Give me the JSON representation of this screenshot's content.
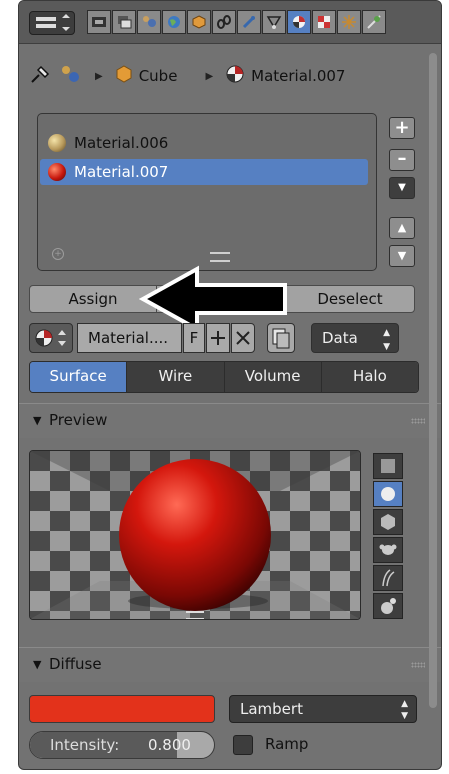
{
  "breadcrumb": {
    "object": "Cube",
    "material": "Material.007"
  },
  "slots": [
    {
      "name": "Material.006",
      "color": "#b89a5c",
      "selected": false
    },
    {
      "name": "Material.007",
      "color": "#c8180e",
      "selected": true
    }
  ],
  "buttons": {
    "assign": "Assign",
    "deselect": "Deselect"
  },
  "selector": {
    "material_name": "Material....",
    "fake_user": "F",
    "link_type": "Data"
  },
  "tabs": [
    "Surface",
    "Wire",
    "Volume",
    "Halo"
  ],
  "sections": {
    "preview": "Preview",
    "diffuse": "Diffuse"
  },
  "diffuse": {
    "color": "#e3321b",
    "shader": "Lambert",
    "intensity_label": "Intensity:",
    "intensity_value": "0.800",
    "ramp_label": "Ramp"
  },
  "colors": {
    "accent": "#5680c2",
    "panel": "#727272",
    "arrow": "#000000"
  },
  "icons": [
    "editor-type-icon",
    "render-icon",
    "render-layers-icon",
    "scene-icon",
    "world-icon",
    "object-icon",
    "constraints-icon",
    "modifiers-icon",
    "data-icon",
    "material-icon",
    "texture-icon",
    "particles-icon",
    "physics-icon",
    "pin-icon",
    "cube-icon",
    "material-ball-icon",
    "plus-icon",
    "minus-icon",
    "move-up-icon",
    "move-down-icon"
  ]
}
